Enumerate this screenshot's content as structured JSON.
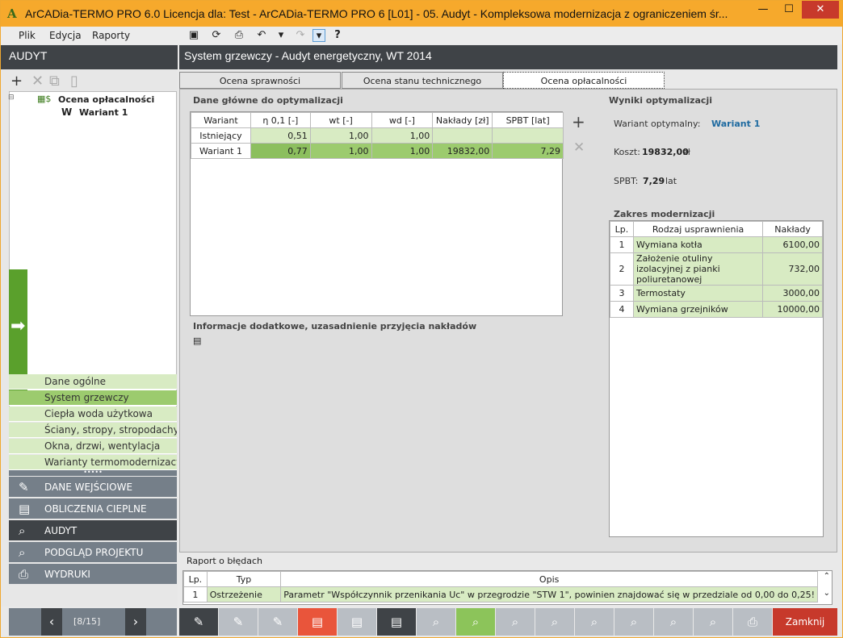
{
  "window": {
    "title": "ArCADia-TERMO PRO 6.0 Licencja dla: Test - ArCADia-TERMO PRO 6 [L01] - 05. Audyt - Kompleksowa modernizacja z ograniczeniem śr...",
    "min": "—",
    "max": "☐",
    "close": "✕"
  },
  "menu": {
    "items": [
      "Plik",
      "Edycja",
      "Raporty"
    ]
  },
  "left": {
    "header": "AUDYT",
    "tree": {
      "root": "Ocena opłacalności",
      "child": "Wariant 1"
    },
    "subnav": [
      "Dane ogólne",
      "System grzewczy",
      "Ciepła woda użytkowa",
      "Ściany, stropy, stropodachy",
      "Okna, drzwi, wentylacja",
      "Warianty termomodernizacyjne"
    ],
    "mainnav": [
      "DANE WEJŚCIOWE",
      "OBLICZENIA CIEPLNE",
      "AUDYT",
      "PODGLĄD PROJEKTU",
      "WYDRUKI"
    ]
  },
  "content": {
    "header": "System grzewczy - Audyt energetyczny, WT 2014",
    "tabs": [
      "Ocena sprawności",
      "Ocena stanu technicznego",
      "Ocena opłacalności"
    ],
    "opt": {
      "title": "Dane główne do optymalizacji",
      "cols": [
        "Wariant",
        "η 0,1 [-]",
        "wt [-]",
        "wd [-]",
        "Nakłady [zł]",
        "SPBT [lat]"
      ],
      "rows": [
        [
          "Istniejący",
          "0,51",
          "1,00",
          "1,00",
          "",
          ""
        ],
        [
          "Wariant 1",
          "0,77",
          "1,00",
          "1,00",
          "19832,00",
          "7,29"
        ]
      ]
    },
    "info": {
      "title": "Informacje dodatkowe, uzasadnienie przyjęcia nakładów"
    },
    "wyniki": {
      "title": "Wyniki optymalizacji",
      "wariant_label": "Wariant optymalny:",
      "wariant_val": "Wariant 1",
      "koszt_label": "Koszt:",
      "koszt_val": "19832,00",
      "koszt_unit": "zł",
      "spbt_label": "SPBT:",
      "spbt_val": "7,29",
      "spbt_unit": "lat"
    },
    "zakres": {
      "title": "Zakres modernizacji",
      "cols": [
        "Lp.",
        "Rodzaj usprawnienia",
        "Nakłady"
      ],
      "rows": [
        [
          "1",
          "Wymiana kotła",
          "6100,00"
        ],
        [
          "2",
          "Założenie otuliny izolacyjnej z pianki poliuretanowej",
          "732,00"
        ],
        [
          "3",
          "Termostaty",
          "3000,00"
        ],
        [
          "4",
          "Wymiana grzejników",
          "10000,00"
        ]
      ]
    },
    "raport": {
      "title": "Raport o błędach",
      "cols": [
        "Lp.",
        "Typ",
        "Opis"
      ],
      "rows": [
        [
          "1",
          "Ostrzeżenie",
          "Parametr \"Współczynnik przenikania Uc\" w przegrodzie \"STW 1\", powinien znajdować się w przedziale od 0,00 do 0,25!"
        ]
      ]
    }
  },
  "bottom": {
    "page": "[8/15]",
    "close": "Zamknij"
  },
  "colors": {
    "accent": "#f6a92c",
    "dark": "#3f4347",
    "green": "#9ccb6e",
    "lightgreen": "#d8ebc3",
    "red": "#c7392b",
    "link": "#1e6aa0"
  }
}
